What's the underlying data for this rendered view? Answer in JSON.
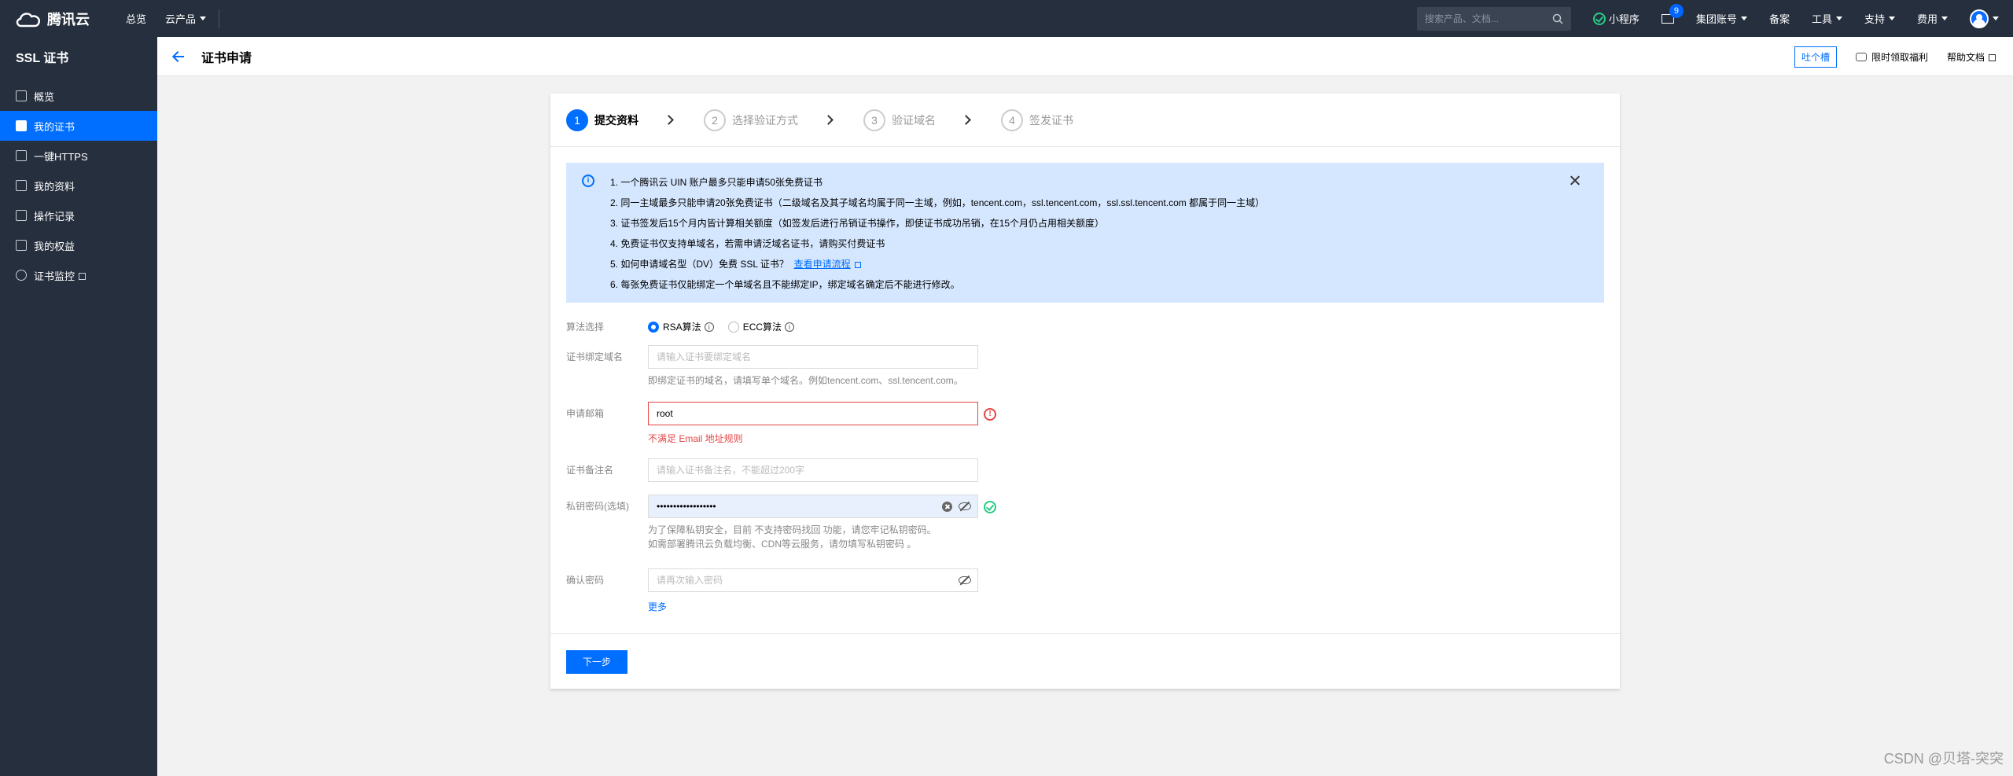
{
  "topbar": {
    "brand": "腾讯云",
    "nav": [
      "总览",
      "云产品"
    ],
    "search_placeholder": "搜索产品、文档...",
    "items": [
      "小程序",
      "集团账号",
      "备案",
      "工具",
      "支持",
      "费用"
    ],
    "mail_badge": "9"
  },
  "sidebar": {
    "title": "SSL 证书",
    "items": [
      {
        "label": "概览"
      },
      {
        "label": "我的证书"
      },
      {
        "label": "一键HTTPS"
      },
      {
        "label": "我的资料"
      },
      {
        "label": "操作记录"
      },
      {
        "label": "我的权益"
      },
      {
        "label": "证书监控"
      }
    ],
    "active_index": 1
  },
  "header": {
    "title": "证书申请",
    "tucao": "吐个槽",
    "promo": "限时领取福利",
    "docs": "帮助文档"
  },
  "steps": [
    {
      "num": "1",
      "label": "提交资料"
    },
    {
      "num": "2",
      "label": "选择验证方式"
    },
    {
      "num": "3",
      "label": "验证域名"
    },
    {
      "num": "4",
      "label": "签发证书"
    }
  ],
  "notice": {
    "items": [
      "1. 一个腾讯云 UIN 账户最多只能申请50张免费证书",
      "2. 同一主域最多只能申请20张免费证书（二级域名及其子域名均属于同一主域，例如，tencent.com，ssl.tencent.com，ssl.ssl.tencent.com 都属于同一主域）",
      "3. 证书签发后15个月内皆计算相关额度（如签发后进行吊销证书操作，即使证书成功吊销，在15个月仍占用相关额度）",
      "4. 免费证书仅支持单域名，若需申请泛域名证书，请购买付费证书",
      "5. 如何申请域名型（DV）免费 SSL 证书？",
      "6. 每张免费证书仅能绑定一个单域名且不能绑定IP，绑定域名确定后不能进行修改。"
    ],
    "link": "查看申请流程"
  },
  "form": {
    "algo_label": "算法选择",
    "algo_rsa": "RSA算法",
    "algo_ecc": "ECC算法",
    "domain_label": "证书绑定域名",
    "domain_placeholder": "请输入证书要绑定域名",
    "domain_help": "即绑定证书的域名，请填写单个域名。例如tencent.com、ssl.tencent.com。",
    "email_label": "申请邮箱",
    "email_value": "root",
    "email_error": "不满足 Email 地址规则",
    "remark_label": "证书备注名",
    "remark_placeholder": "请输入证书备注名，不能超过200字",
    "pw_label": "私钥密码(选填)",
    "pw_value": "••••••••••••••••••",
    "pw_help_1": "为了保障私钥安全，目前 不支持密码找回 功能，请您牢记私钥密码。",
    "pw_help_2": "如需部署腾讯云负载均衡、CDN等云服务，请勿填写私钥密码 。",
    "confirm_label": "确认密码",
    "confirm_placeholder": "请再次输入密码",
    "more": "更多",
    "next": "下一步"
  },
  "watermark": "CSDN @贝塔-突突"
}
